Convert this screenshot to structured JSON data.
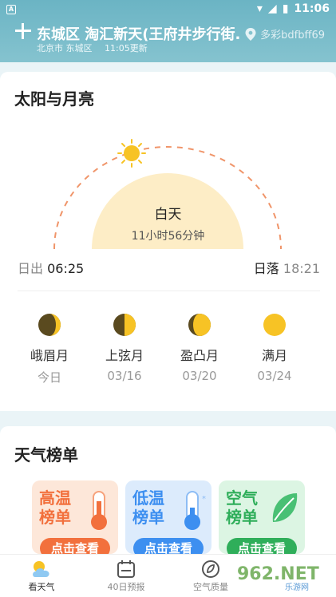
{
  "status": {
    "time": "11:06"
  },
  "header": {
    "title": "东城区 淘汇新天(王府井步行街..",
    "region": "北京市 东城区",
    "updated": "11:05更新",
    "location_label": "多彩bdfbff69"
  },
  "sun_moon": {
    "title": "太阳与月亮",
    "day_label": "白天",
    "day_length": "11小时56分钟",
    "sunrise_label": "日出",
    "sunrise_time": "06:25",
    "sunset_label": "日落",
    "sunset_time": "18:21",
    "moons": [
      {
        "name": "峨眉月",
        "date": "今日",
        "phase": "waxing-crescent"
      },
      {
        "name": "上弦月",
        "date": "03/16",
        "phase": "first-quarter"
      },
      {
        "name": "盈凸月",
        "date": "03/20",
        "phase": "waxing-gibbous"
      },
      {
        "name": "满月",
        "date": "03/24",
        "phase": "full"
      }
    ]
  },
  "rankings": {
    "title": "天气榜单",
    "cards": [
      {
        "title": "高温榜单",
        "button": "点击查看",
        "accent": "#f2703d",
        "bg": "#fde7d9"
      },
      {
        "title": "低温榜单",
        "button": "点击查看",
        "accent": "#3d8ff0",
        "bg": "#dcebfc"
      },
      {
        "title": "空气榜单",
        "button": "点击查看",
        "accent": "#2fae5a",
        "bg": "#dcf5e3"
      }
    ]
  },
  "nav": {
    "items": [
      {
        "label": "看天气",
        "icon": "weather-icon",
        "active": true
      },
      {
        "label": "40日预报",
        "icon": "calendar-icon",
        "active": false
      },
      {
        "label": "空气质量",
        "icon": "leaf-icon",
        "active": false
      }
    ]
  },
  "watermark": {
    "text": "962.NET",
    "sub": "乐游网"
  },
  "colors": {
    "header": "#6bb4c4",
    "sun": "#f7c325",
    "arc": "#f0956a",
    "day_fill": "#fdedc6"
  }
}
